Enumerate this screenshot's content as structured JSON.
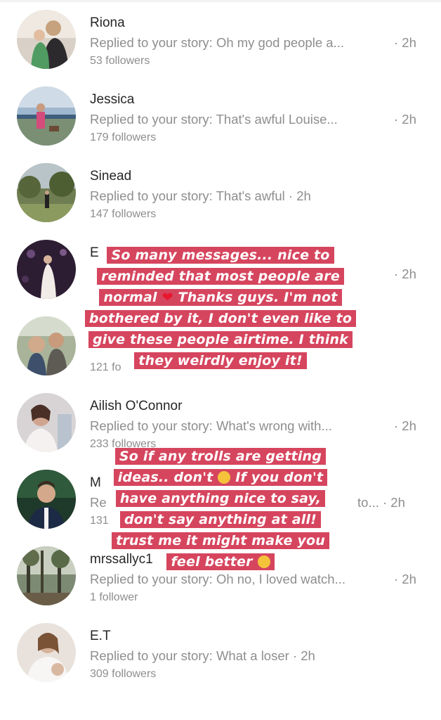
{
  "rows": [
    {
      "name": "Riona",
      "reply": "Replied to your story: Oh my god people a...",
      "time": "· 2h",
      "followers": "53 followers"
    },
    {
      "name": "Jessica",
      "reply": "Replied to your story: That's awful Louise...",
      "time": "· 2h",
      "followers": "179 followers"
    },
    {
      "name": "Sinead",
      "reply": "Replied to your story: That's awful",
      "time": "· 2h",
      "followers": "147 followers"
    },
    {
      "name": "E",
      "reply": "",
      "time": "· 2h",
      "followers": ""
    },
    {
      "name": "",
      "reply": "",
      "time": "",
      "followers": "121 fo"
    },
    {
      "name": "Ailish O'Connor",
      "reply": "Replied to your story: What's wrong with...",
      "time": "· 2h",
      "followers": "233 followers"
    },
    {
      "name": "M",
      "reply": "Re",
      "time": "to... · 2h",
      "followers": "131"
    },
    {
      "name": "mrssallyc1",
      "reply": "Replied to your story: Oh no, I loved watch...",
      "time": "· 2h",
      "followers": "1 follower"
    },
    {
      "name": "E.T",
      "reply": "Replied to your story: What a loser",
      "time": "· 2h",
      "followers": "309 followers"
    }
  ],
  "overlay_top": {
    "line1": "So many messages... nice to",
    "line2": "reminded that most people are",
    "line3a": "normal",
    "line3b": "Thanks guys. I'm not",
    "line4": "bothered by it, I don't even like to",
    "line5": "give these people airtime. I think",
    "line6": "they weirdly enjoy it!"
  },
  "overlay_bottom": {
    "line1": "So if any trolls are getting",
    "line2a": "ideas.. don't",
    "line2b": "If you don't",
    "line3": "have anything nice to say,",
    "line4": "don't say anything at all!",
    "line5": "trust me it might make you",
    "line6": "feel better"
  },
  "icons": {
    "heart": "heart-emoji",
    "laugh": "laughing-emoji",
    "upside": "upside-down-face-emoji"
  },
  "colors": {
    "highlight": "#d6455e",
    "secondary_text": "#8e8e8e",
    "primary_text": "#262626"
  }
}
